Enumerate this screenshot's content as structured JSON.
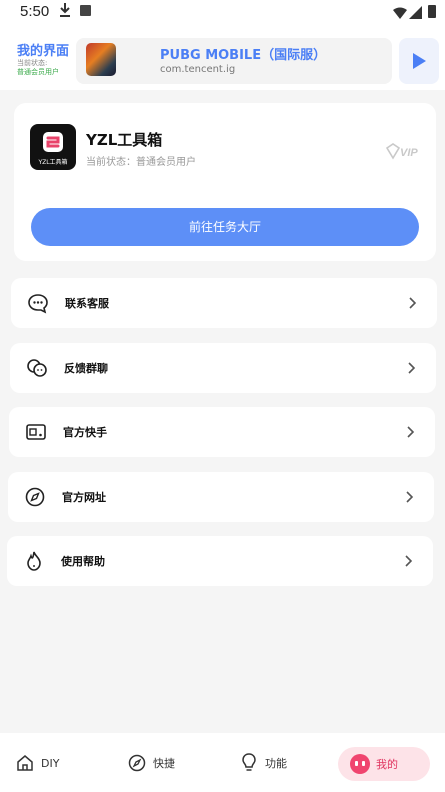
{
  "status_bar": {
    "time": "5:50"
  },
  "header": {
    "title": "我的界面",
    "sub_label": "当前状态:",
    "sub_status": "普通会员用户",
    "app": {
      "name": "PUBG MOBILE（国际服）",
      "package": "com.tencent.ig"
    }
  },
  "profile": {
    "name": "YZL工具箱",
    "logo_caption": "YZL工具箱",
    "status_text": "当前状态：普通会员用户",
    "vip_badge": "VIP",
    "task_button": "前往任务大厅"
  },
  "menu": [
    {
      "label": "联系客服",
      "icon": "chat-bubble-icon"
    },
    {
      "label": "反馈群聊",
      "icon": "group-chat-icon"
    },
    {
      "label": "官方快手",
      "icon": "video-icon"
    },
    {
      "label": "官方网址",
      "icon": "compass-icon"
    },
    {
      "label": "使用帮助",
      "icon": "flame-help-icon"
    }
  ],
  "bottom_nav": [
    {
      "label": "DIY",
      "icon": "home-icon"
    },
    {
      "label": "快捷",
      "icon": "compass-icon"
    },
    {
      "label": "功能",
      "icon": "lightbulb-icon"
    },
    {
      "label": "我的",
      "icon": "profile-face-icon",
      "active": true
    }
  ],
  "colors": {
    "accent_blue": "#4b7ff5",
    "button_blue": "#5d8ff7",
    "active_pink": "#f0456f"
  }
}
